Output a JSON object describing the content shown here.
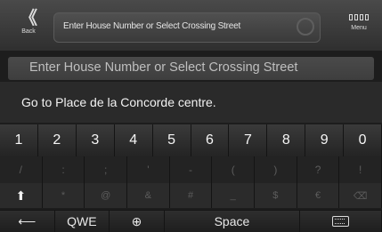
{
  "header": {
    "back_glyph": "《",
    "back_label": "Back",
    "title": "Enter House Number or Select Crossing Street",
    "menu_label": "Menu",
    "icons": [
      "back-chevron-icon",
      "microphone-icon",
      "menu-grid-icon"
    ]
  },
  "input": {
    "placeholder": "Enter House Number or Select Crossing Street"
  },
  "suggestion": "Go to Place de la Concorde centre.",
  "keyboard": {
    "numbers": [
      "1",
      "2",
      "3",
      "4",
      "5",
      "6",
      "7",
      "8",
      "9",
      "0"
    ],
    "symbols_row1": [
      "/",
      ":",
      ";",
      "'",
      "-",
      "(",
      ")",
      "?",
      "!"
    ],
    "symbols_row2": [
      "*",
      "@",
      "&",
      "#",
      "_",
      "$",
      "€"
    ],
    "shift_glyph": "⬆",
    "backspace_glyph": "⌫",
    "bottom": {
      "left_arrow": "⟵",
      "qwerty": "QWE",
      "globe": "⊕",
      "space": "Space"
    }
  },
  "colors": {
    "background": "#1d1d1d",
    "bar": "#3a3a3a",
    "text": "#f2f2f2"
  }
}
